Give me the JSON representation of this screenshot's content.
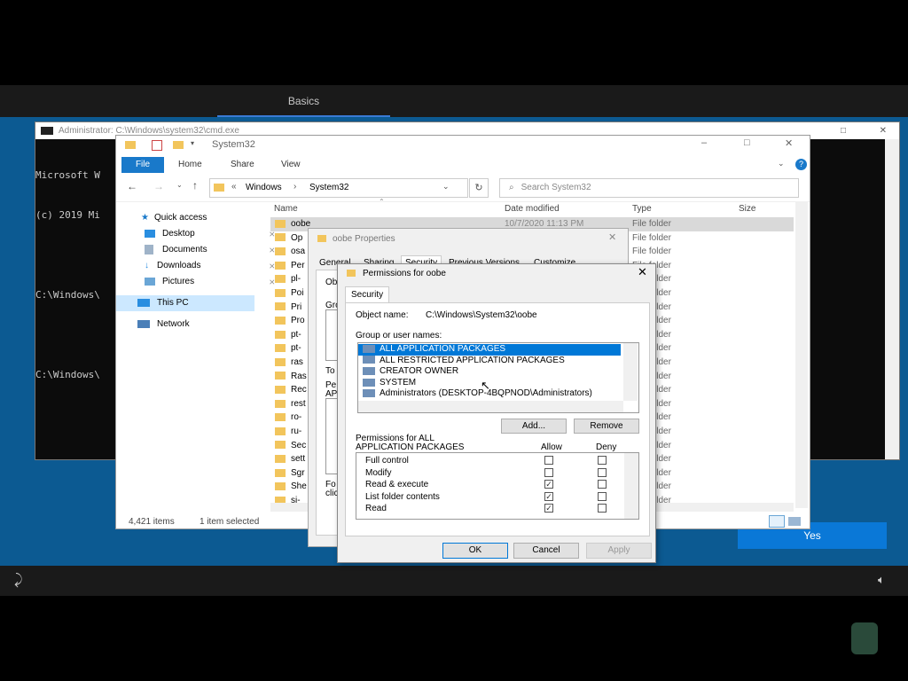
{
  "oobe": {
    "tab": "Basics",
    "yes_button": "Yes"
  },
  "cmd": {
    "title": "Administrator: C:\\Windows\\system32\\cmd.exe",
    "lines": [
      "Microsoft W",
      "(c) 2019 Mi",
      "",
      "C:\\Windows\\",
      "",
      "C:\\Windows\\"
    ]
  },
  "explorer": {
    "title": "System32",
    "ribbon_tabs": [
      "File",
      "Home",
      "Share",
      "View"
    ],
    "breadcrumb": [
      "Windows",
      "System32"
    ],
    "search_placeholder": "Search System32",
    "columns": [
      "Name",
      "Date modified",
      "Type",
      "Size"
    ],
    "sidebar": [
      {
        "label": "Quick access",
        "pinned": false
      },
      {
        "label": "Desktop",
        "pinned": true
      },
      {
        "label": "Documents",
        "pinned": true
      },
      {
        "label": "Downloads",
        "pinned": true
      },
      {
        "label": "Pictures",
        "pinned": true
      },
      {
        "label": "This PC",
        "pinned": false
      },
      {
        "label": "Network",
        "pinned": false
      }
    ],
    "rows": [
      {
        "name": "oobe",
        "date": "10/7/2020 11:13 PM",
        "type": "File folder"
      },
      {
        "name": "Op",
        "date": "",
        "type": "File folder"
      },
      {
        "name": "osa",
        "date": "",
        "type": "File folder"
      },
      {
        "name": "Per",
        "date": "",
        "type": "File folder"
      },
      {
        "name": "pl-",
        "date": "",
        "type": "File folder"
      },
      {
        "name": "Poi",
        "date": "",
        "type": "File folder"
      },
      {
        "name": "Pri",
        "date": "",
        "type": "File folder"
      },
      {
        "name": "Pro",
        "date": "",
        "type": "File folder"
      },
      {
        "name": "pt-",
        "date": "",
        "type": "File folder"
      },
      {
        "name": "pt-",
        "date": "",
        "type": "File folder"
      },
      {
        "name": "ras",
        "date": "",
        "type": "File folder"
      },
      {
        "name": "Ras",
        "date": "",
        "type": "File folder"
      },
      {
        "name": "Rec",
        "date": "",
        "type": "File folder"
      },
      {
        "name": "rest",
        "date": "",
        "type": "File folder"
      },
      {
        "name": "ro-",
        "date": "",
        "type": "File folder"
      },
      {
        "name": "ru-",
        "date": "",
        "type": "File folder"
      },
      {
        "name": "Sec",
        "date": "",
        "type": "File folder"
      },
      {
        "name": "sett",
        "date": "",
        "type": "File folder"
      },
      {
        "name": "Sgr",
        "date": "",
        "type": "File folder"
      },
      {
        "name": "She",
        "date": "",
        "type": "File folder"
      },
      {
        "name": "si-",
        "date": "",
        "type": "File folder"
      }
    ],
    "status_count": "4,421 items",
    "status_selected": "1 item selected"
  },
  "properties": {
    "title": "oobe Properties",
    "tabs": [
      "General",
      "Sharing",
      "Security",
      "Previous Versions",
      "Customize"
    ],
    "fragments": [
      "Ob",
      "Gro",
      "To",
      "Pe",
      "AP",
      "Fo",
      "clic"
    ]
  },
  "permissions": {
    "title": "Permissions for oobe",
    "tab": "Security",
    "object_label": "Object name:",
    "object_value": "C:\\Windows\\System32\\oobe",
    "group_label": "Group or user names:",
    "groups": [
      "ALL APPLICATION PACKAGES",
      "ALL RESTRICTED APPLICATION PACKAGES",
      "CREATOR OWNER",
      "SYSTEM",
      "Administrators (DESKTOP-4BQPNOD\\Administrators)"
    ],
    "add_button": "Add...",
    "remove_button": "Remove",
    "perm_label_1": "Permissions for ALL",
    "perm_label_2": "APPLICATION PACKAGES",
    "allow_label": "Allow",
    "deny_label": "Deny",
    "permissions": [
      {
        "name": "Full control",
        "allow": false,
        "deny": false
      },
      {
        "name": "Modify",
        "allow": false,
        "deny": false
      },
      {
        "name": "Read & execute",
        "allow": true,
        "deny": false
      },
      {
        "name": "List folder contents",
        "allow": true,
        "deny": false
      },
      {
        "name": "Read",
        "allow": true,
        "deny": false
      }
    ],
    "ok_button": "OK",
    "cancel_button": "Cancel",
    "apply_button": "Apply"
  },
  "colors": {
    "oobe_blue": "#0c5a92",
    "accent": "#0a78d7",
    "selection": "#0078d7"
  }
}
